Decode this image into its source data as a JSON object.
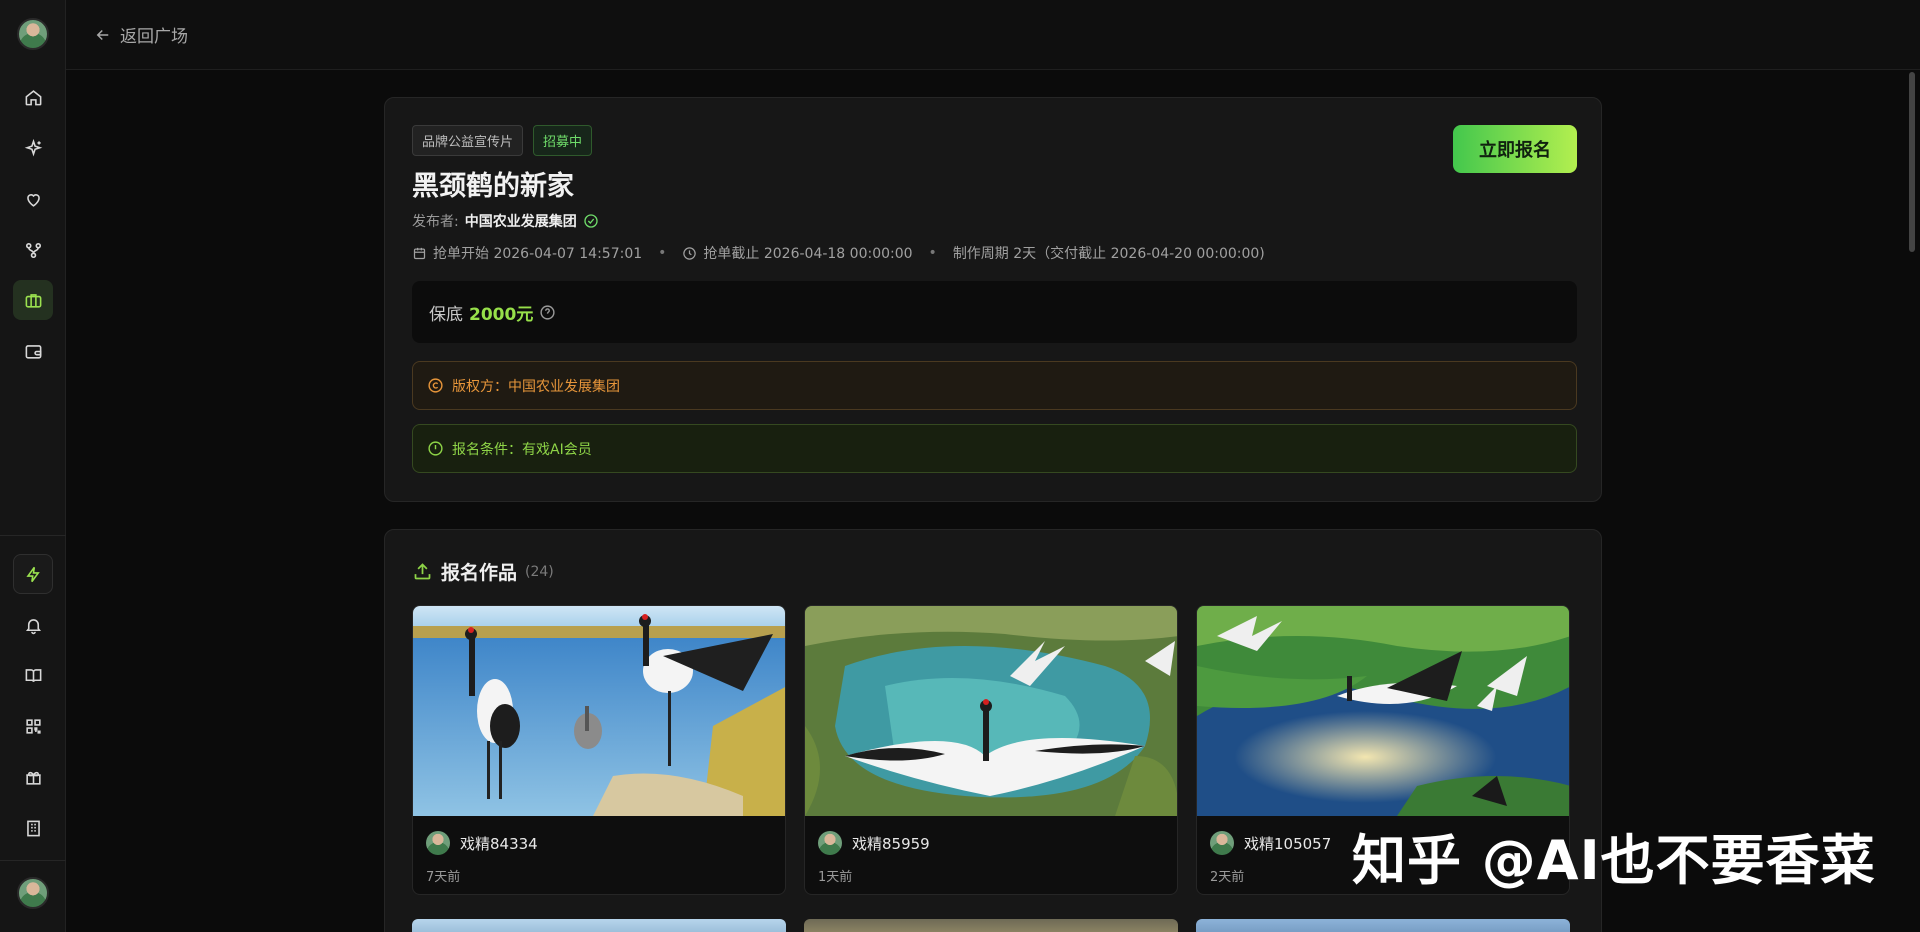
{
  "nav": {
    "back_label": "返回广场"
  },
  "campaign": {
    "tags": [
      "品牌公益宣传片",
      "招募中"
    ],
    "title": "黑颈鹤的新家",
    "publisher_label": "发布者:",
    "publisher_name": "中国农业发展集团",
    "start": "抢单开始 2026-04-07 14:57:01",
    "deadline": "抢单截止 2026-04-18 00:00:00",
    "cycle": "制作周期 2天（交付截止 2026-04-20 00:00:00)",
    "apply_label": "立即报名",
    "price_label": "保底",
    "price_amount": "2000元",
    "copyright": "版权方：中国农业发展集团",
    "condition": "报名条件：有戏AI会员"
  },
  "works": {
    "title": "报名作品",
    "count": "(24)",
    "items": [
      {
        "user": "戏精84334",
        "time": "7天前"
      },
      {
        "user": "戏精85959",
        "time": "1天前"
      },
      {
        "user": "戏精105057",
        "time": "2天前"
      }
    ]
  },
  "watermark": "知乎 @AI也不要香菜",
  "colors": {
    "accent": "#97e04a",
    "copyright": "#e6953a",
    "condition": "#8ed447",
    "background": "#0b0b0b"
  },
  "icons": {
    "sidebar": [
      "home-icon",
      "sparkle-icon",
      "heart-icon",
      "flow-icon",
      "briefcase-icon",
      "wallet-icon",
      "bolt-icon",
      "bell-icon",
      "book-icon",
      "qr-icon",
      "gift-icon",
      "building-icon"
    ]
  }
}
